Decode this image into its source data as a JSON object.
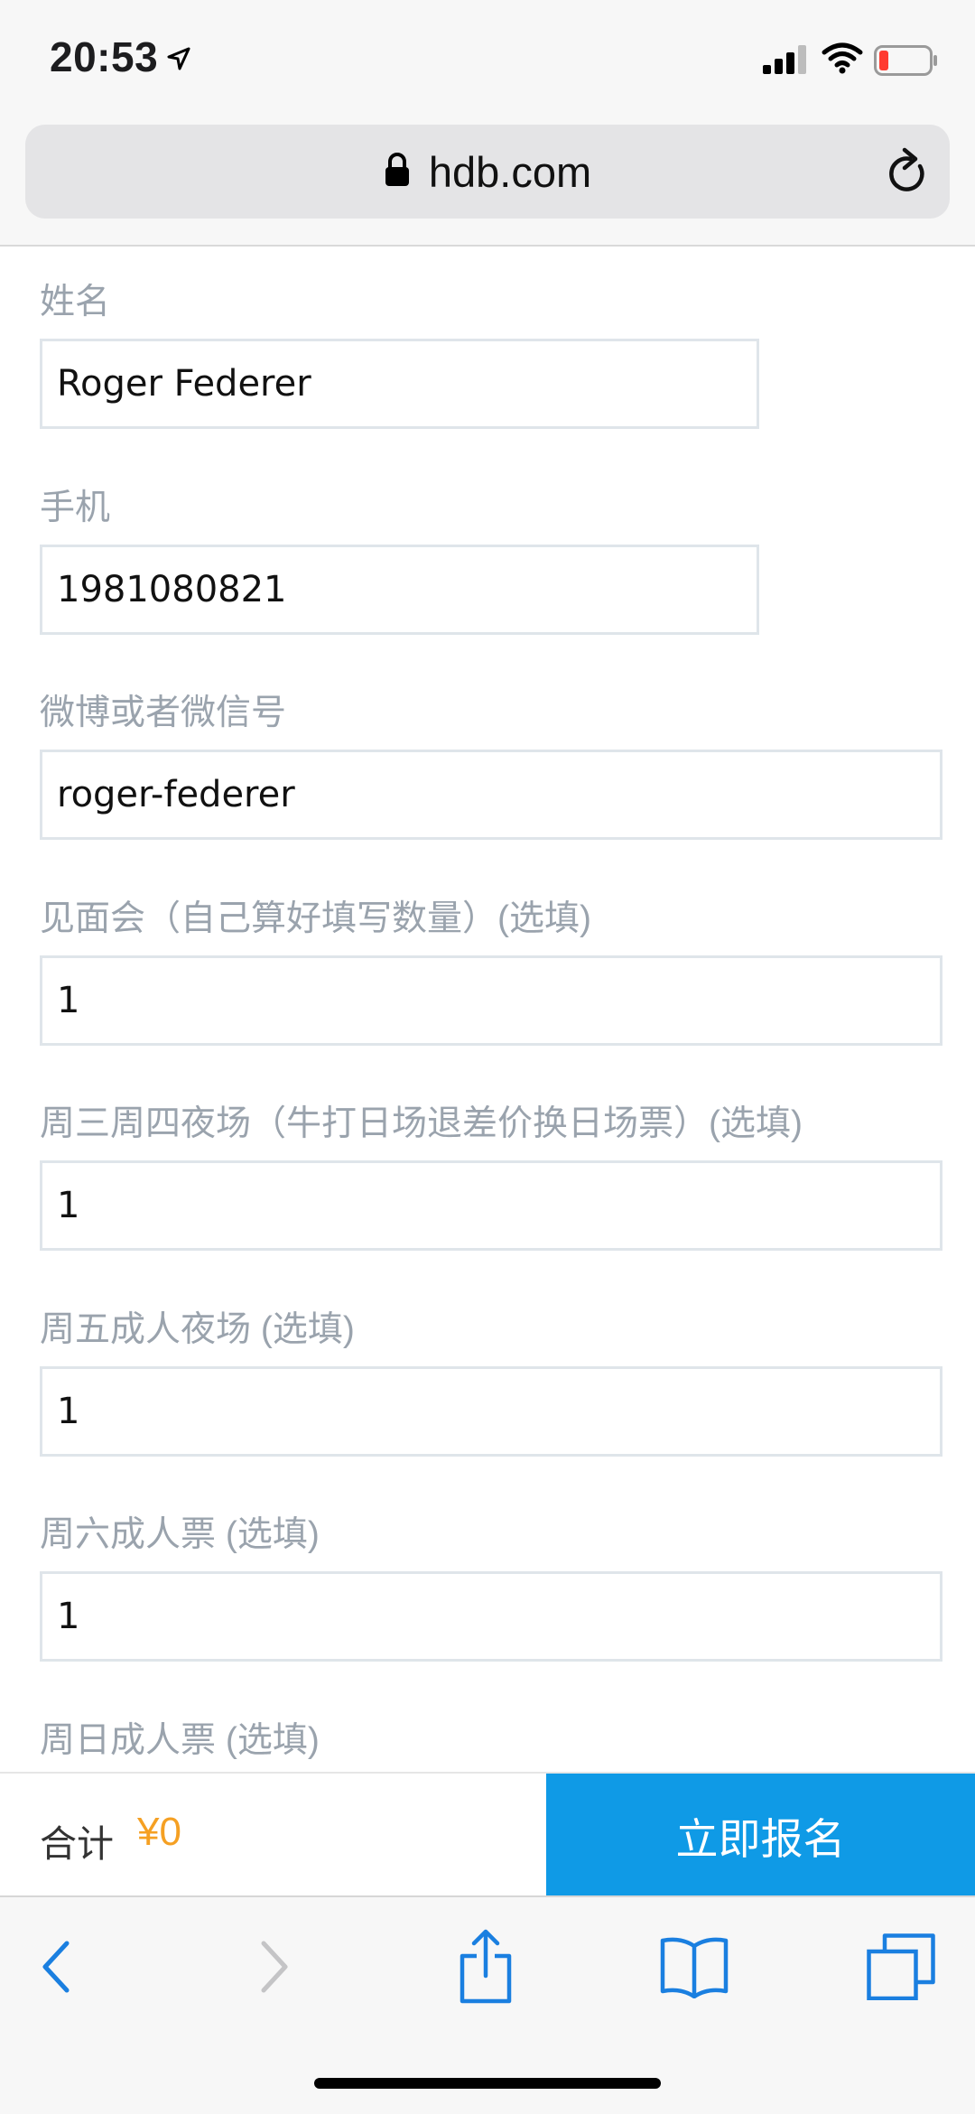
{
  "status_bar": {
    "time": "20:53",
    "icons": [
      "location-arrow-icon",
      "cellular-signal-icon",
      "wifi-icon",
      "battery-low-icon"
    ]
  },
  "url_bar": {
    "domain": "hdb.com",
    "icons": [
      "lock-icon",
      "reload-icon"
    ]
  },
  "form": {
    "fields": [
      {
        "label": "姓名",
        "value": "Roger Federer"
      },
      {
        "label": "手机",
        "value": "1981080821"
      },
      {
        "label": "微博或者微信号",
        "value": "roger-federer"
      },
      {
        "label": "见面会（自己算好填写数量）(选填)",
        "value": "1"
      },
      {
        "label": "周三周四夜场（牛打日场退差价换日场票）(选填)",
        "value": "1"
      },
      {
        "label": "周五成人夜场 (选填)",
        "value": "1"
      },
      {
        "label": "周六成人票 (选填)",
        "value": "1"
      },
      {
        "label": "周日成人票 (选填)"
      }
    ]
  },
  "action_bar": {
    "total_label": "合计",
    "total_amount": "¥0",
    "signup_label": "立即报名",
    "colors": {
      "amount": "#f5a023",
      "button": "#0f9ae6"
    }
  },
  "toolbar": {
    "icons": [
      "back-icon",
      "forward-icon",
      "share-icon",
      "bookmarks-icon",
      "tabs-icon"
    ]
  }
}
